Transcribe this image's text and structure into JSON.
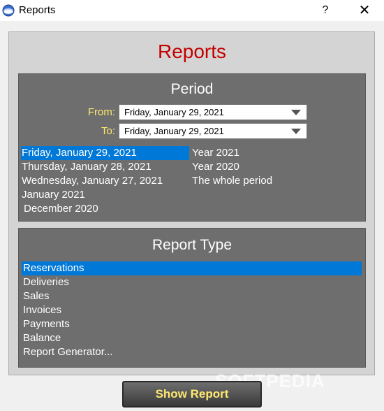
{
  "window": {
    "title": "Reports",
    "help_label": "?",
    "close_label": "✕"
  },
  "header": {
    "title": "Reports"
  },
  "period": {
    "title": "Period",
    "from_label": "From:",
    "to_label": "To:",
    "from_value": "Friday, January 29, 2021",
    "to_value": "Friday, January 29, 2021",
    "left_items": [
      "Friday, January 29, 2021",
      "Thursday, January 28, 2021",
      "Wednesday, January 27, 2021",
      "January 2021",
      "December 2020"
    ],
    "right_items": [
      "Year 2021",
      "Year 2020",
      "The whole period"
    ]
  },
  "report_type": {
    "title": "Report Type",
    "items": [
      "Reservations",
      "Deliveries",
      "Sales",
      "Invoices",
      "Payments",
      "Balance",
      "Report Generator..."
    ]
  },
  "actions": {
    "show_report": "Show Report"
  },
  "watermark": "SOFTPEDIA",
  "colors": {
    "accent_selection": "#0078d7",
    "title_red": "#c40000",
    "label_yellow": "#ffe96f"
  }
}
